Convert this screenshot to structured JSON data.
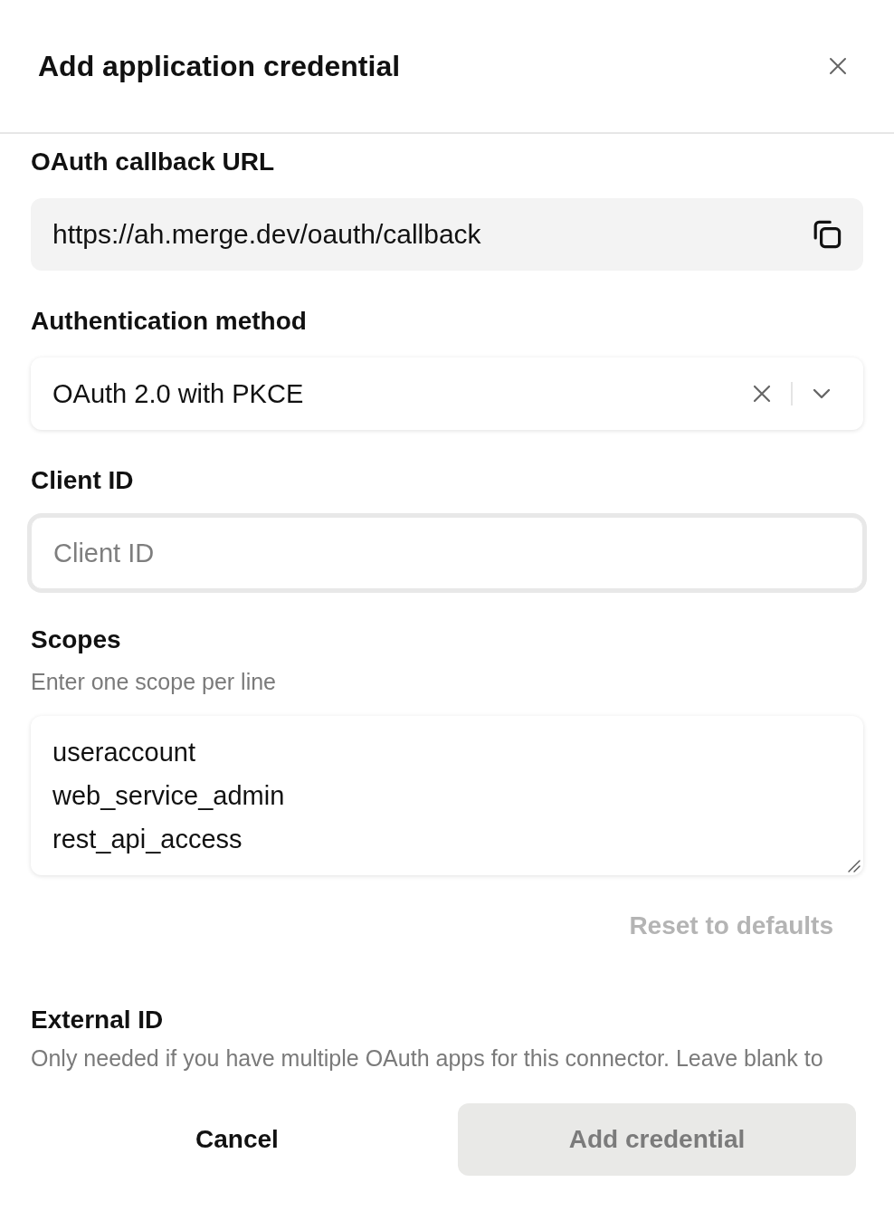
{
  "dialog": {
    "title": "Add application credential"
  },
  "callback_url": {
    "label": "OAuth callback URL",
    "value": "https://ah.merge.dev/oauth/callback"
  },
  "auth_method": {
    "label": "Authentication method",
    "value": "OAuth 2.0 with PKCE"
  },
  "client_id": {
    "label": "Client ID",
    "placeholder": "Client ID",
    "focused": true
  },
  "scopes": {
    "label": "Scopes",
    "hint": "Enter one scope per line",
    "value": "useraccount\nweb_service_admin\nrest_api_access",
    "reset_button": {
      "label": "Reset to defaults",
      "disabled": true
    }
  },
  "external_id": {
    "label": "External ID",
    "description": "Only needed if you have multiple OAuth apps for this connector. Leave blank to"
  },
  "buttons": [
    {
      "label": "Cancel",
      "kind": "secondary",
      "disabled": false
    },
    {
      "label": "Add credential",
      "kind": "primary",
      "disabled": true
    }
  ]
}
